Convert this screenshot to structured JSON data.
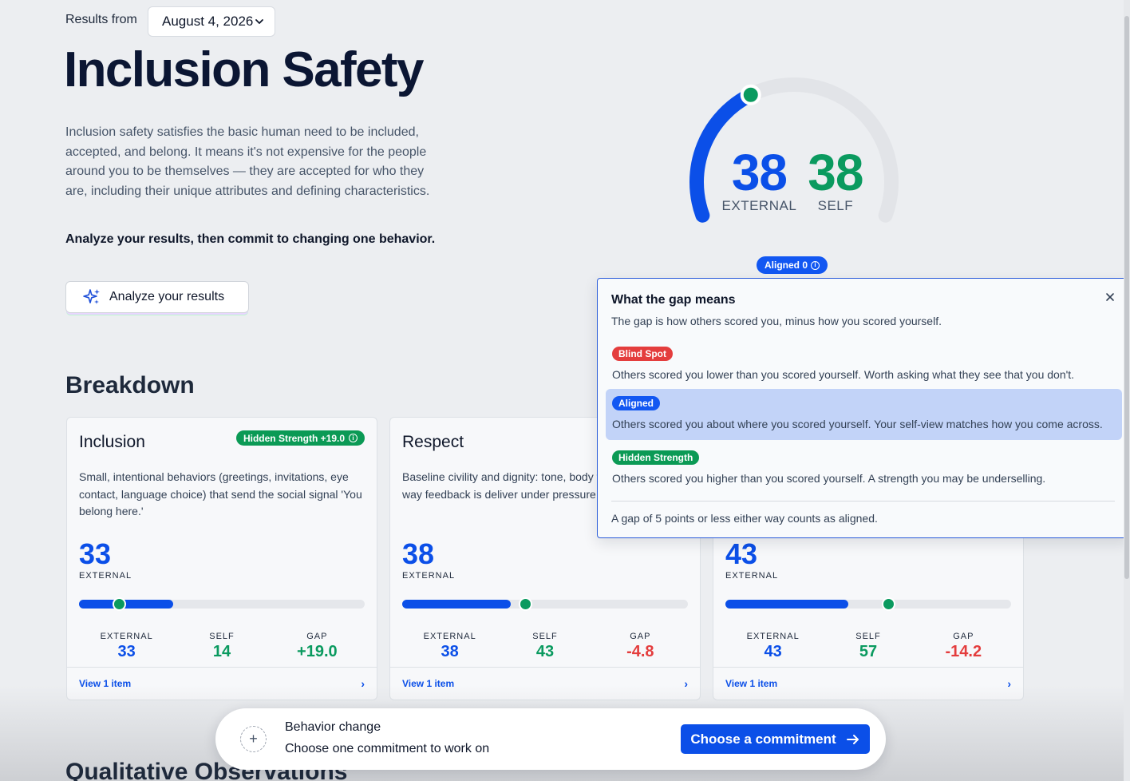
{
  "header": {
    "results_from": "Results from",
    "date": "August 4, 2026",
    "title": "Inclusion Safety",
    "intro": "Inclusion safety satisfies the basic human need to be included, accepted, and belong. It means it's not expensive for the people around you to be themselves — they are accepted for who they are, including their unique attributes and defining characteristics.",
    "cta": "Analyze your results, then commit to changing one behavior.",
    "analyze_button": "Analyze your results"
  },
  "gauge": {
    "external": "38",
    "self": "38",
    "external_label": "EXTERNAL",
    "self_label": "SELF",
    "badge": "Aligned 0",
    "value_fraction": 0.38
  },
  "breakdown": {
    "title": "Breakdown",
    "cards": [
      {
        "title": "Inclusion",
        "badge": "Hidden Strength +19.0",
        "description": "Small, intentional behaviors (greetings, invitations, eye contact, language choice) that send the social signal 'You belong here.'",
        "score": "33",
        "score_label": "EXTERNAL",
        "external_pct": 33,
        "self_pct": 14,
        "stats": {
          "external_label": "EXTERNAL",
          "external": "33",
          "self_label": "SELF",
          "self": "14",
          "gap_label": "GAP",
          "gap": "+19.0"
        },
        "footer": "View 1 item"
      },
      {
        "title": "Respect",
        "badge": "",
        "description": "Baseline civility and dignity: tone, body timing, and the way feedback is deliver under pressure.",
        "score": "38",
        "score_label": "EXTERNAL",
        "external_pct": 38,
        "self_pct": 43,
        "stats": {
          "external_label": "EXTERNAL",
          "external": "38",
          "self_label": "SELF",
          "self": "43",
          "gap_label": "GAP",
          "gap": "-4.8"
        },
        "footer": "View 1 item"
      },
      {
        "title": "",
        "badge": "",
        "description": "",
        "score": "43",
        "score_label": "EXTERNAL",
        "external_pct": 43,
        "self_pct": 57,
        "stats": {
          "external_label": "EXTERNAL",
          "external": "43",
          "self_label": "SELF",
          "self": "57",
          "gap_label": "GAP",
          "gap": "-14.2"
        },
        "footer": "View 1 item"
      }
    ]
  },
  "popover": {
    "title": "What the gap means",
    "subtitle": "The gap is how others scored you, minus how you scored yourself.",
    "rows": [
      {
        "label": "Blind Spot",
        "color": "#e43d3d",
        "text": "Others scored you lower than you scored yourself. Worth asking what they see that you don't."
      },
      {
        "label": "Aligned",
        "color": "#1257f2",
        "text": "Others scored you about where you scored yourself. Your self-view matches how you come across."
      },
      {
        "label": "Hidden Strength",
        "color": "#0b9a55",
        "text": "Others scored you higher than you scored yourself. A strength you may be underselling."
      }
    ],
    "note": "A gap of 5 points or less either way counts as aligned."
  },
  "commit_bar": {
    "label": "Behavior change",
    "sub": "Choose one commitment to work on",
    "button": "Choose a commitment"
  },
  "next_section": "Qualitative Observations",
  "colors": {
    "blue": "#0b4fe8",
    "green": "#0a9a5f",
    "red": "#e43d3d"
  }
}
